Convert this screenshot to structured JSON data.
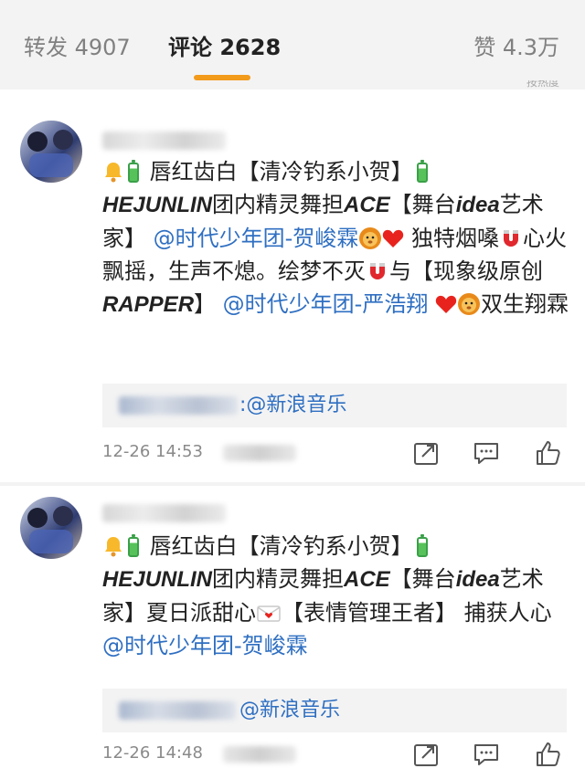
{
  "tabs": {
    "forward": "转发 4907",
    "comment": "评论 2628",
    "like": "赞 4.3万",
    "sort_hint": "按热度"
  },
  "colors": {
    "accent": "#f29a1a",
    "link": "#2f6fc2"
  },
  "comments": [
    {
      "segments": {
        "s1": "唇红齿白【清冷钓系小贺】",
        "s2": "HEJUNLIN",
        "s3": "团内精灵舞担",
        "s4": "ACE",
        "s5": "【舞台",
        "s6": "idea",
        "s7": "艺术家】",
        "m1": "@时代少年团-贺峻霖",
        "s8": " 独特烟嗓",
        "s9": "心火飘摇，生声不熄。绘梦不灭",
        "s10": "与【现象级原创",
        "s11": "RAPPER",
        "s12": "】",
        "m2": "@时代少年团-严浩翔",
        "s13": "双生翔霖"
      },
      "source": ":@新浪音乐",
      "time": "12-26 14:53"
    },
    {
      "segments": {
        "s1": "唇红齿白【清冷钓系小贺】",
        "s2": "HEJUNLIN",
        "s3": "团内精灵舞担",
        "s4": "ACE",
        "s5": "【舞台",
        "s6": "idea",
        "s7": "艺术家】夏日派甜心",
        "s8": "【表情管理王者】 捕获人心",
        "m1": "@时代少年团-贺峻霖"
      },
      "source": "@新浪音乐",
      "time": "12-26 14:48"
    }
  ],
  "icons": [
    "bell-icon",
    "battery-icon",
    "lion-icon",
    "heart-icon",
    "magnet-icon",
    "love-letter-icon",
    "share-icon",
    "comment-icon",
    "like-icon"
  ]
}
